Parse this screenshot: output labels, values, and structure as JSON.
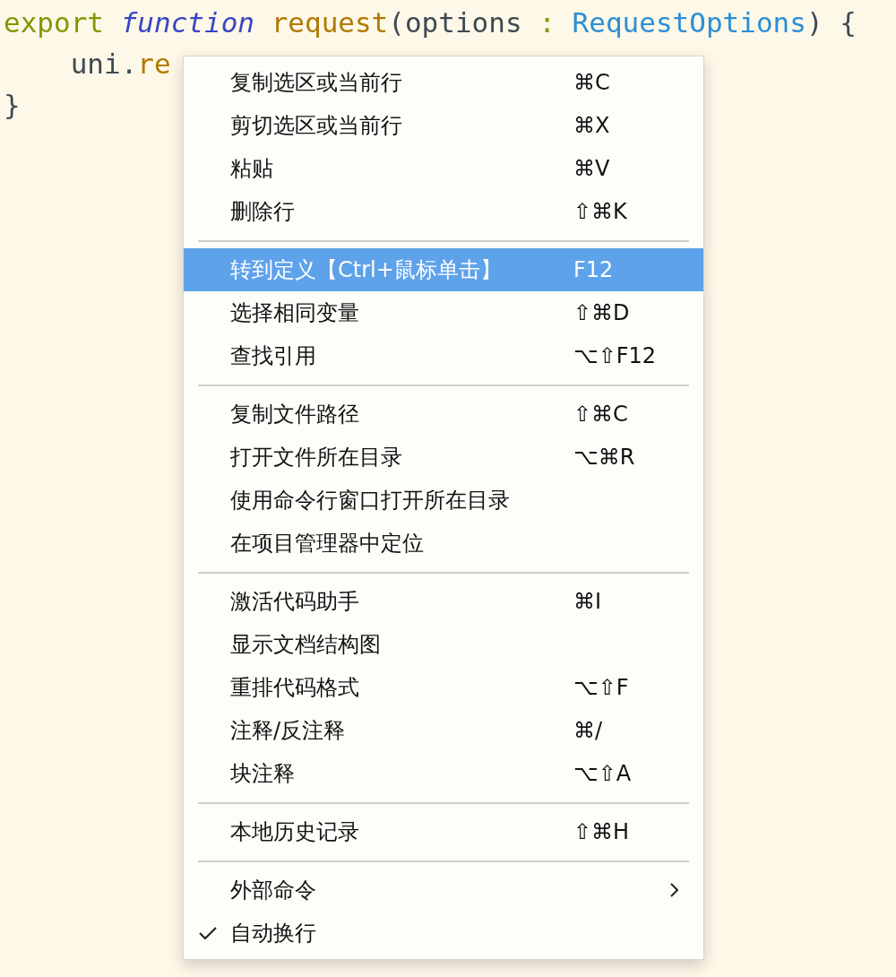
{
  "editor": {
    "lines": [
      [
        {
          "kind": "keyword",
          "text": "export "
        },
        {
          "kind": "storage",
          "text": "function "
        },
        {
          "kind": "func",
          "text": "request"
        },
        {
          "kind": "plain",
          "text": "(options "
        },
        {
          "kind": "keyword",
          "text": ": "
        },
        {
          "kind": "type",
          "text": "RequestOptions"
        },
        {
          "kind": "plain",
          "text": ") {"
        }
      ],
      [
        {
          "kind": "plain",
          "text": "    uni."
        },
        {
          "kind": "func",
          "text": "re"
        }
      ],
      [
        {
          "kind": "plain",
          "text": "}"
        }
      ]
    ]
  },
  "context_menu": {
    "groups": [
      {
        "items": [
          {
            "label": "复制选区或当前行",
            "shortcut": "⌘C",
            "selected": false,
            "checked": false,
            "submenu": false
          },
          {
            "label": "剪切选区或当前行",
            "shortcut": "⌘X",
            "selected": false,
            "checked": false,
            "submenu": false
          },
          {
            "label": "粘贴",
            "shortcut": "⌘V",
            "selected": false,
            "checked": false,
            "submenu": false
          },
          {
            "label": "删除行",
            "shortcut": "⇧⌘K",
            "selected": false,
            "checked": false,
            "submenu": false
          }
        ]
      },
      {
        "items": [
          {
            "label": "转到定义【Ctrl+鼠标单击】",
            "shortcut": "F12",
            "selected": true,
            "checked": false,
            "submenu": false
          },
          {
            "label": "选择相同变量",
            "shortcut": "⇧⌘D",
            "selected": false,
            "checked": false,
            "submenu": false
          },
          {
            "label": "查找引用",
            "shortcut": "⌥⇧F12",
            "selected": false,
            "checked": false,
            "submenu": false
          }
        ]
      },
      {
        "items": [
          {
            "label": "复制文件路径",
            "shortcut": "⇧⌘C",
            "selected": false,
            "checked": false,
            "submenu": false
          },
          {
            "label": "打开文件所在目录",
            "shortcut": "⌥⌘R",
            "selected": false,
            "checked": false,
            "submenu": false
          },
          {
            "label": "使用命令行窗口打开所在目录",
            "selected": false,
            "checked": false,
            "submenu": false
          },
          {
            "label": "在项目管理器中定位",
            "selected": false,
            "checked": false,
            "submenu": false
          }
        ]
      },
      {
        "items": [
          {
            "label": "激活代码助手",
            "shortcut": "⌘I",
            "selected": false,
            "checked": false,
            "submenu": false
          },
          {
            "label": "显示文档结构图",
            "selected": false,
            "checked": false,
            "submenu": false
          },
          {
            "label": "重排代码格式",
            "shortcut": "⌥⇧F",
            "selected": false,
            "checked": false,
            "submenu": false
          },
          {
            "label": "注释/反注释",
            "shortcut": "⌘/",
            "selected": false,
            "checked": false,
            "submenu": false
          },
          {
            "label": "块注释",
            "shortcut": "⌥⇧A",
            "selected": false,
            "checked": false,
            "submenu": false
          }
        ]
      },
      {
        "items": [
          {
            "label": "本地历史记录",
            "shortcut": "⇧⌘H",
            "selected": false,
            "checked": false,
            "submenu": false
          }
        ]
      },
      {
        "items": [
          {
            "label": "外部命令",
            "selected": false,
            "checked": false,
            "submenu": true
          },
          {
            "label": "自动换行",
            "selected": false,
            "checked": true,
            "submenu": false
          }
        ]
      }
    ]
  }
}
